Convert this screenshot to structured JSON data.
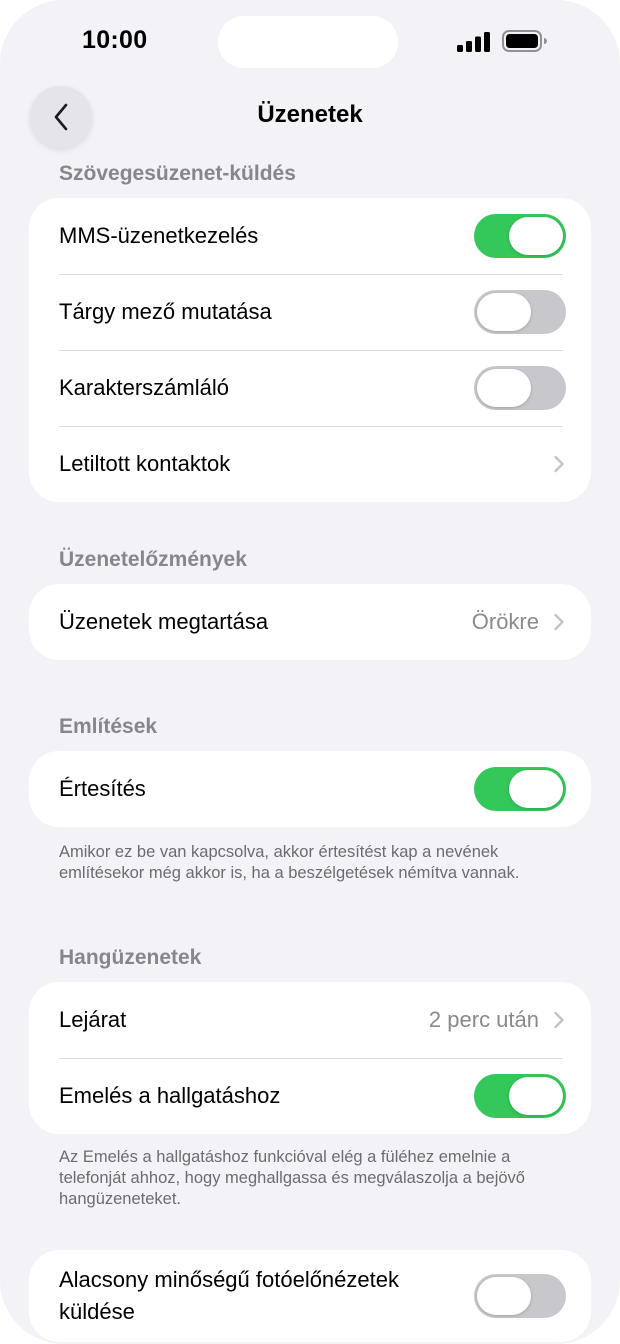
{
  "status_bar": {
    "time": "10:00",
    "signal_icon": "cellular-signal-icon",
    "battery_icon": "battery-full-icon"
  },
  "nav": {
    "back_icon": "chevron-left-icon",
    "title": "Üzenetek"
  },
  "colors": {
    "toggle_on": "#34c759",
    "toggle_off": "#c7c7cc",
    "background": "#f2f2f7",
    "secondary_text": "#8a8a8e"
  },
  "sections": {
    "texting": {
      "header": "Szövegesüzenet-küldés",
      "rows": [
        {
          "label": "MMS-üzenetkezelés",
          "type": "toggle",
          "on": true
        },
        {
          "label": "Tárgy mező mutatása",
          "type": "toggle",
          "on": false
        },
        {
          "label": "Karakterszámláló",
          "type": "toggle",
          "on": false
        },
        {
          "label": "Letiltott kontaktok",
          "type": "link"
        }
      ]
    },
    "history": {
      "header": "Üzenetelőzmények",
      "rows": [
        {
          "label": "Üzenetek megtartása",
          "type": "link",
          "value": "Örökre"
        }
      ]
    },
    "mentions": {
      "header": "Említések",
      "rows": [
        {
          "label": "Értesítés",
          "type": "toggle",
          "on": true
        }
      ],
      "footer": "Amikor ez be van kapcsolva, akkor értesítést kap a nevének említésekor még akkor is, ha a beszélgetések némítva vannak."
    },
    "audio": {
      "header": "Hangüzenetek",
      "rows": [
        {
          "label": "Lejárat",
          "type": "link",
          "value": "2 perc után"
        },
        {
          "label": "Emelés a hallgatáshoz",
          "type": "toggle",
          "on": true
        }
      ],
      "footer": "Az Emelés a hallgatáshoz funkcióval elég a füléhez emelnie a telefonját ahhoz, hogy meghallgassa és megválaszolja a bejövő hangüzeneteket."
    },
    "media": {
      "rows": [
        {
          "label": "Alacsony minőségű fotóelőnézetek küldése",
          "type": "toggle",
          "on": false
        }
      ]
    }
  }
}
